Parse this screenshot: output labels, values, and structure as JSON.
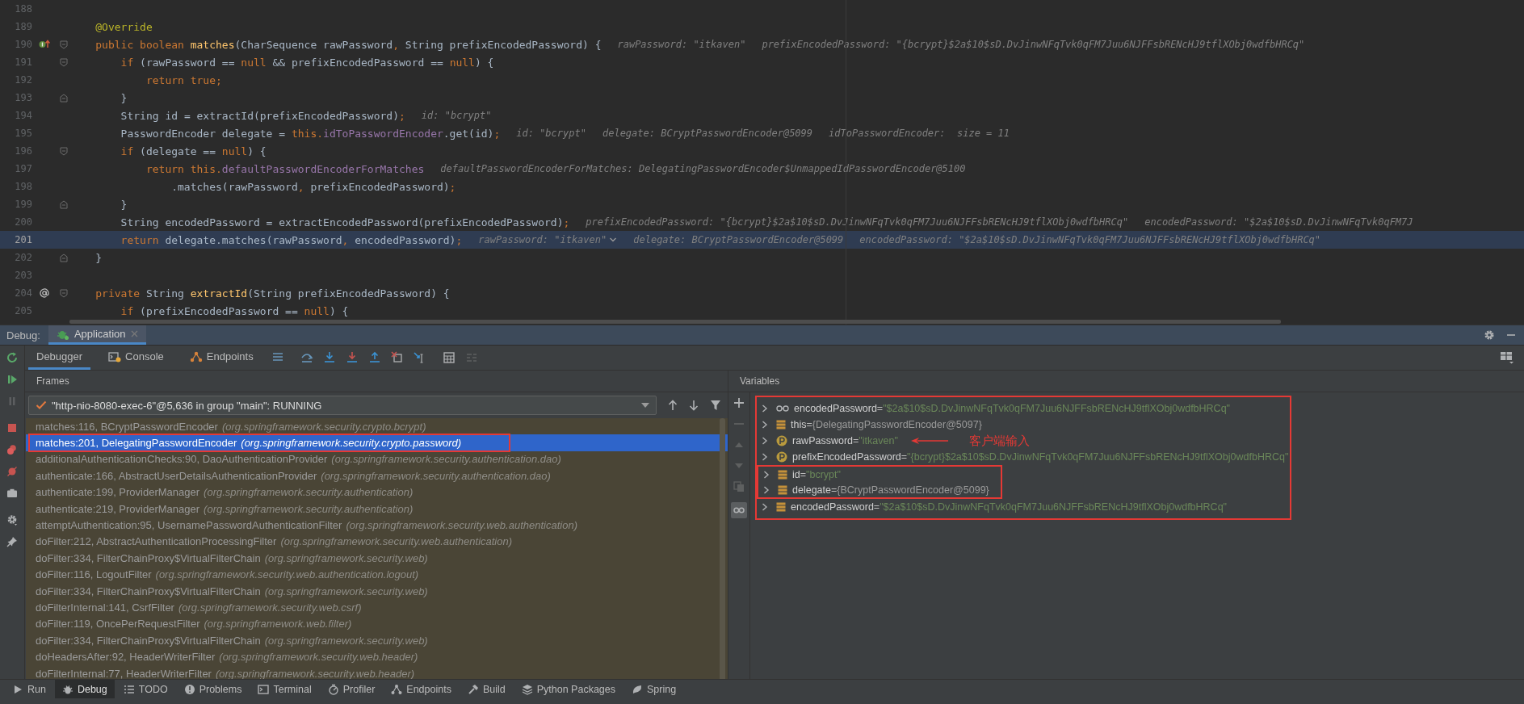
{
  "editor": {
    "lines": [
      {
        "number": "188",
        "current": false,
        "collapsible": false
      },
      {
        "number": "189",
        "current": false,
        "collapsible": false,
        "tokens": [
          {
            "kind": "annotation",
            "text": "@Override"
          }
        ]
      },
      {
        "number": "190",
        "current": false,
        "collapsible": true,
        "marker": {
          "kind": "override"
        },
        "tokens": [
          {
            "kind": "keyword",
            "text": "public boolean "
          },
          {
            "kind": "method",
            "text": "matches"
          },
          {
            "kind": "plain",
            "text": "(CharSequence rawPassword"
          },
          {
            "kind": "keyword",
            "text": ", "
          },
          {
            "kind": "plain",
            "text": "String prefixEncodedPassword) {"
          }
        ],
        "hints": [
          {
            "text": "rawPassword: \"itkaven\"",
            "expandable": false
          },
          {
            "text": "prefixEncodedPassword: \"{bcrypt}$2a$10$sD.DvJinwNFqTvk0qFM7Juu6NJFFsbRENcHJ9tflXObj0wdfbHRCq\"",
            "expandable": false
          }
        ],
        "children": [
          {
            "number": "191",
            "current": false,
            "collapsible": true,
            "tokens": [
              {
                "kind": "keyword",
                "text": "if "
              },
              {
                "kind": "plain",
                "text": "(rawPassword == "
              },
              {
                "kind": "keyword",
                "text": "null "
              },
              {
                "kind": "plain",
                "text": "&& prefixEncodedPassword == "
              },
              {
                "kind": "keyword",
                "text": "null"
              },
              {
                "kind": "plain",
                "text": ") {"
              }
            ],
            "children": [
              {
                "number": "192",
                "current": false,
                "collapsible": false,
                "tokens": [
                  {
                    "kind": "keyword",
                    "text": "return true;"
                  }
                ]
              }
            ],
            "closing": {
              "number": "193",
              "current": false,
              "text": "}"
            }
          },
          {
            "number": "194",
            "current": false,
            "collapsible": false,
            "tokens": [
              {
                "kind": "plain",
                "text": "String id = extractId(prefixEncodedPassword)"
              },
              {
                "kind": "keyword",
                "text": ";"
              }
            ],
            "hints": [
              {
                "text": "id: \"bcrypt\"",
                "expandable": false
              }
            ]
          },
          {
            "number": "195",
            "current": false,
            "collapsible": false,
            "tokens": [
              {
                "kind": "plain",
                "text": "PasswordEncoder delegate = "
              },
              {
                "kind": "keyword",
                "text": "this."
              },
              {
                "kind": "field",
                "text": "idToPasswordEncoder"
              },
              {
                "kind": "plain",
                "text": ".get(id)"
              },
              {
                "kind": "keyword",
                "text": ";"
              }
            ],
            "hints": [
              {
                "text": "id: \"bcrypt\"",
                "expandable": false
              },
              {
                "text": "delegate: BCryptPasswordEncoder@5099",
                "expandable": false
              },
              {
                "text": "idToPasswordEncoder:  size = 11",
                "expandable": false
              }
            ]
          },
          {
            "number": "196",
            "current": false,
            "collapsible": true,
            "tokens": [
              {
                "kind": "keyword",
                "text": "if "
              },
              {
                "kind": "plain",
                "text": "(delegate == "
              },
              {
                "kind": "keyword",
                "text": "null"
              },
              {
                "kind": "plain",
                "text": ") {"
              }
            ],
            "children": [
              {
                "number": "197",
                "current": false,
                "collapsible": false,
                "tokens": [
                  {
                    "kind": "keyword",
                    "text": "return this."
                  },
                  {
                    "kind": "field",
                    "text": "defaultPasswordEncoderForMatches"
                  }
                ],
                "hints": [
                  {
                    "text": "defaultPasswordEncoderForMatches: DelegatingPasswordEncoder$UnmappedIdPasswordEncoder@5100",
                    "expandable": false
                  }
                ],
                "children": [
                  {
                    "number": "198",
                    "current": false,
                    "collapsible": false,
                    "tokens": [
                      {
                        "kind": "plain",
                        "text": ".matches(rawPassword"
                      },
                      {
                        "kind": "keyword",
                        "text": ", "
                      },
                      {
                        "kind": "plain",
                        "text": "prefixEncodedPassword)"
                      },
                      {
                        "kind": "keyword",
                        "text": ";"
                      }
                    ]
                  }
                ]
              }
            ],
            "closing": {
              "number": "199",
              "current": false,
              "text": "}"
            }
          },
          {
            "number": "200",
            "current": false,
            "collapsible": false,
            "tokens": [
              {
                "kind": "plain",
                "text": "String encodedPassword = extractEncodedPassword(prefixEncodedPassword)"
              },
              {
                "kind": "keyword",
                "text": ";"
              }
            ],
            "hints": [
              {
                "text": "prefixEncodedPassword: \"{bcrypt}$2a$10$sD.DvJinwNFqTvk0qFM7Juu6NJFFsbRENcHJ9tflXObj0wdfbHRCq\"",
                "expandable": false
              },
              {
                "text": "encodedPassword: \"$2a$10$sD.DvJinwNFqTvk0qFM7J",
                "expandable": false
              }
            ]
          },
          {
            "number": "201",
            "current": true,
            "collapsible": false,
            "tokens": [
              {
                "kind": "keyword",
                "text": "return "
              },
              {
                "kind": "plain",
                "text": "delegate.matches(rawPassword"
              },
              {
                "kind": "keyword",
                "text": ", "
              },
              {
                "kind": "plain",
                "text": "encodedPassword)"
              },
              {
                "kind": "keyword",
                "text": ";"
              }
            ],
            "hints": [
              {
                "text": "rawPassword: \"itkaven\"",
                "expandable": true
              },
              {
                "text": "delegate: BCryptPasswordEncoder@5099",
                "expandable": false
              },
              {
                "text": "encodedPassword: \"$2a$10$sD.DvJinwNFqTvk0qFM7Juu6NJFFsbRENcHJ9tflXObj0wdfbHRCq\"",
                "expandable": false
              }
            ]
          }
        ],
        "closing": {
          "number": "202",
          "current": false,
          "text": "}"
        }
      },
      {
        "number": "203",
        "current": false,
        "collapsible": false
      },
      {
        "number": "204",
        "current": false,
        "collapsible": true,
        "marker": {
          "kind": "implements"
        },
        "tokens": [
          {
            "kind": "keyword",
            "text": "private "
          },
          {
            "kind": "plain",
            "text": "String "
          },
          {
            "kind": "method",
            "text": "extractId"
          },
          {
            "kind": "plain",
            "text": "(String prefixEncodedPassword) {"
          }
        ],
        "children": [
          {
            "number": "205",
            "current": false,
            "collapsible": false,
            "tokens": [
              {
                "kind": "keyword",
                "text": "if "
              },
              {
                "kind": "plain",
                "text": "(prefixEncodedPassword == "
              },
              {
                "kind": "keyword",
                "text": "null"
              },
              {
                "kind": "plain",
                "text": ") {"
              }
            ]
          }
        ]
      }
    ]
  },
  "debug": {
    "label": "Debug:",
    "session_tabs": [
      {
        "label": "Application",
        "selected": true
      }
    ],
    "tabs": [
      {
        "label": "Debugger",
        "selected": true
      },
      {
        "label": "Console",
        "selected": false
      },
      {
        "label": "Endpoints",
        "selected": false
      }
    ],
    "frames": {
      "title": "Frames",
      "thread": "\"http-nio-8080-exec-6\"@5,636 in group \"main\": RUNNING",
      "rows": [
        {
          "location": "matches:116, BCryptPasswordEncoder",
          "package": "(org.springframework.security.crypto.bcrypt)",
          "selected": false,
          "highlighted": false
        },
        {
          "location": "matches:201, DelegatingPasswordEncoder",
          "package": "(org.springframework.security.crypto.password)",
          "selected": true,
          "highlighted": true
        },
        {
          "location": "additionalAuthenticationChecks:90, DaoAuthenticationProvider",
          "package": "(org.springframework.security.authentication.dao)",
          "selected": false,
          "highlighted": false
        },
        {
          "location": "authenticate:166, AbstractUserDetailsAuthenticationProvider",
          "package": "(org.springframework.security.authentication.dao)",
          "selected": false,
          "highlighted": false
        },
        {
          "location": "authenticate:199, ProviderManager",
          "package": "(org.springframework.security.authentication)",
          "selected": false,
          "highlighted": false
        },
        {
          "location": "authenticate:219, ProviderManager",
          "package": "(org.springframework.security.authentication)",
          "selected": false,
          "highlighted": false
        },
        {
          "location": "attemptAuthentication:95, UsernamePasswordAuthenticationFilter",
          "package": "(org.springframework.security.web.authentication)",
          "selected": false,
          "highlighted": false
        },
        {
          "location": "doFilter:212, AbstractAuthenticationProcessingFilter",
          "package": "(org.springframework.security.web.authentication)",
          "selected": false,
          "highlighted": false
        },
        {
          "location": "doFilter:334, FilterChainProxy$VirtualFilterChain",
          "package": "(org.springframework.security.web)",
          "selected": false,
          "highlighted": false
        },
        {
          "location": "doFilter:116, LogoutFilter",
          "package": "(org.springframework.security.web.authentication.logout)",
          "selected": false,
          "highlighted": false
        },
        {
          "location": "doFilter:334, FilterChainProxy$VirtualFilterChain",
          "package": "(org.springframework.security.web)",
          "selected": false,
          "highlighted": false
        },
        {
          "location": "doFilterInternal:141, CsrfFilter",
          "package": "(org.springframework.security.web.csrf)",
          "selected": false,
          "highlighted": false
        },
        {
          "location": "doFilter:119, OncePerRequestFilter",
          "package": "(org.springframework.web.filter)",
          "selected": false,
          "highlighted": false
        },
        {
          "location": "doFilter:334, FilterChainProxy$VirtualFilterChain",
          "package": "(org.springframework.security.web)",
          "selected": false,
          "highlighted": false
        },
        {
          "location": "doHeadersAfter:92, HeaderWriterFilter",
          "package": "(org.springframework.security.web.header)",
          "selected": false,
          "highlighted": false
        },
        {
          "location": "doFilterInternal:77, HeaderWriterFilter",
          "package": "(org.springframework.security.web.header)",
          "selected": false,
          "highlighted": false
        }
      ]
    },
    "variables": {
      "title": "Variables",
      "rows": [
        {
          "kind": "watch",
          "name": "encodedPassword",
          "equals": "=",
          "value": {
            "kind": "string",
            "text": "\"$2a$10$sD.DvJinwNFqTvk0qFM7Juu6NJFFsbRENcHJ9tflXObj0wdfbHRCq\""
          },
          "highlighted": false
        },
        {
          "kind": "field",
          "name": "this",
          "equals": "=",
          "value": {
            "kind": "object",
            "text": "{DelegatingPasswordEncoder@5097}"
          },
          "highlighted": false
        },
        {
          "kind": "parameter",
          "name": "rawPassword",
          "equals": "=",
          "value": {
            "kind": "string",
            "text": "\"itkaven\""
          },
          "highlighted": false,
          "note": "客户端输入"
        },
        {
          "kind": "parameter",
          "name": "prefixEncodedPassword",
          "equals": "=",
          "value": {
            "kind": "string",
            "text": "\"{bcrypt}$2a$10$sD.DvJinwNFqTvk0qFM7Juu6NJFFsbRENcHJ9tflXObj0wdfbHRCq\""
          },
          "highlighted": false
        },
        {
          "kind": "field",
          "name": "id",
          "equals": "=",
          "value": {
            "kind": "string",
            "text": "\"bcrypt\""
          },
          "highlighted": true
        },
        {
          "kind": "field",
          "name": "delegate",
          "equals": "=",
          "value": {
            "kind": "object",
            "text": "{BCryptPasswordEncoder@5099}"
          },
          "highlighted": true
        },
        {
          "kind": "field",
          "name": "encodedPassword",
          "equals": "=",
          "value": {
            "kind": "string",
            "text": "\"$2a$10$sD.DvJinwNFqTvk0qFM7Juu6NJFFsbRENcHJ9tflXObj0wdfbHRCq\""
          },
          "highlighted": false
        }
      ]
    }
  },
  "tool_windows": [
    {
      "label": "Run",
      "selected": false
    },
    {
      "label": "Debug",
      "selected": true
    },
    {
      "label": "TODO",
      "selected": false
    },
    {
      "label": "Problems",
      "selected": false
    },
    {
      "label": "Terminal",
      "selected": false
    },
    {
      "label": "Profiler",
      "selected": false
    },
    {
      "label": "Endpoints",
      "selected": false
    },
    {
      "label": "Build",
      "selected": false
    },
    {
      "label": "Python Packages",
      "selected": false
    },
    {
      "label": "Spring",
      "selected": false
    }
  ]
}
